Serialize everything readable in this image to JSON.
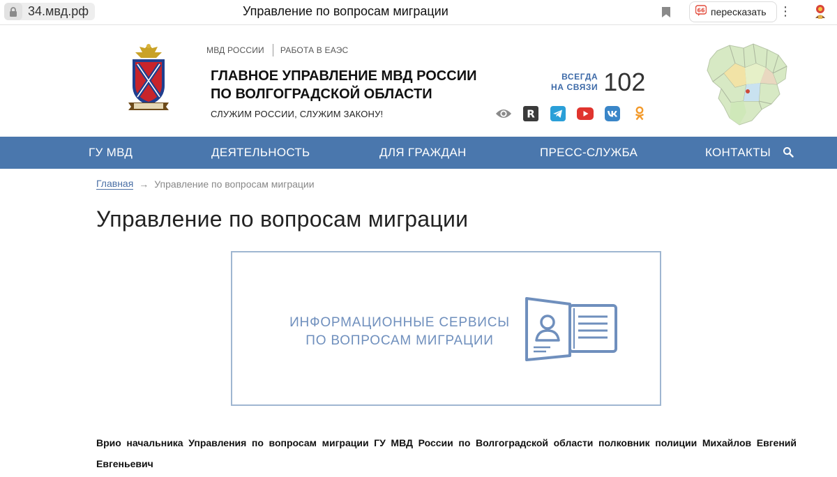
{
  "browser": {
    "url": "34.мвд.рф",
    "tab_title": "Управление по вопросам миграции",
    "retell_label": "пересказать",
    "menu_glyph": "⋮"
  },
  "header": {
    "top_links": [
      "МВД РОССИИ",
      "РАБОТА В ЕАЭС"
    ],
    "title_line1": "ГЛАВНОЕ УПРАВЛЕНИЕ МВД РОССИИ",
    "title_line2": "ПО ВОЛГОГРАДСКОЙ ОБЛАСТИ",
    "slogan": "СЛУЖИМ РОССИИ, СЛУЖИМ ЗАКОНУ!",
    "hotline_line1": "ВСЕГДА",
    "hotline_line2": "НА СВЯЗИ",
    "hotline_number": "102",
    "socials": [
      "eye-icon",
      "rutube-icon",
      "telegram-icon",
      "youtube-icon",
      "vk-icon",
      "odnoklassniki-icon"
    ]
  },
  "nav": {
    "items": [
      "ГУ МВД",
      "ДЕЯТЕЛЬНОСТЬ",
      "ДЛЯ ГРАЖДАН",
      "ПРЕСС-СЛУЖБА",
      "КОНТАКТЫ"
    ]
  },
  "breadcrumb": {
    "home": "Главная",
    "arrow": "→",
    "current": "Управление по вопросам миграции"
  },
  "main": {
    "title": "Управление по вопросам миграции",
    "banner_line1": "ИНФОРМАЦИОННЫЕ СЕРВИСЫ",
    "banner_line2": "ПО ВОПРОСАМ МИГРАЦИИ",
    "chief_text": "Врио начальника Управления по вопросам миграции ГУ МВД России по Волгоградской области полковник полиции Михайлов Евгений Евгеньевич"
  },
  "colors": {
    "nav_bg": "#4a77ad",
    "accent": "#3d6aa8",
    "banner_text": "#6f8fbd"
  }
}
